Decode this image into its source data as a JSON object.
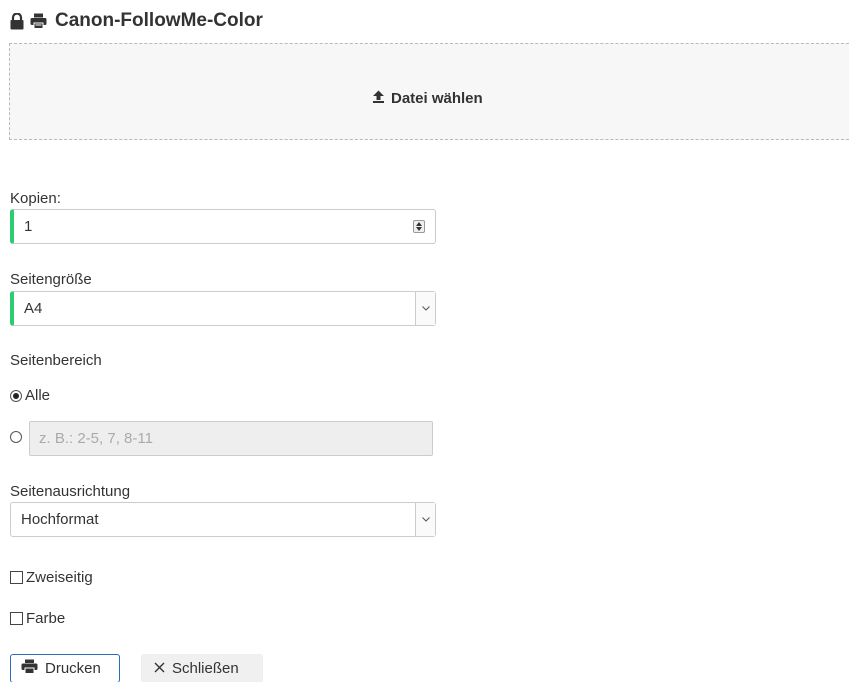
{
  "header": {
    "lock_icon": "lock-icon",
    "printer_icon": "printer-icon",
    "title": "Canon-FollowMe-Color"
  },
  "dropzone": {
    "icon": "upload-icon",
    "label": "Datei wählen"
  },
  "copies": {
    "label": "Kopien:",
    "value": "1"
  },
  "page_size": {
    "label": "Seitengröße",
    "selected": "A4"
  },
  "page_range": {
    "label": "Seitenbereich",
    "all_label": "Alle",
    "all_checked": true,
    "custom_checked": false,
    "custom_placeholder": "z. B.: 2-5, 7, 8-11"
  },
  "orientation": {
    "label": "Seitenausrichtung",
    "selected": "Hochformat"
  },
  "duplex": {
    "label": "Zweiseitig",
    "checked": false
  },
  "color": {
    "label": "Farbe",
    "checked": false
  },
  "buttons": {
    "print_label": "Drucken",
    "close_label": "Schließen"
  },
  "colors": {
    "valid_accent": "#2ecc71",
    "primary_border": "#2a6ebb"
  }
}
